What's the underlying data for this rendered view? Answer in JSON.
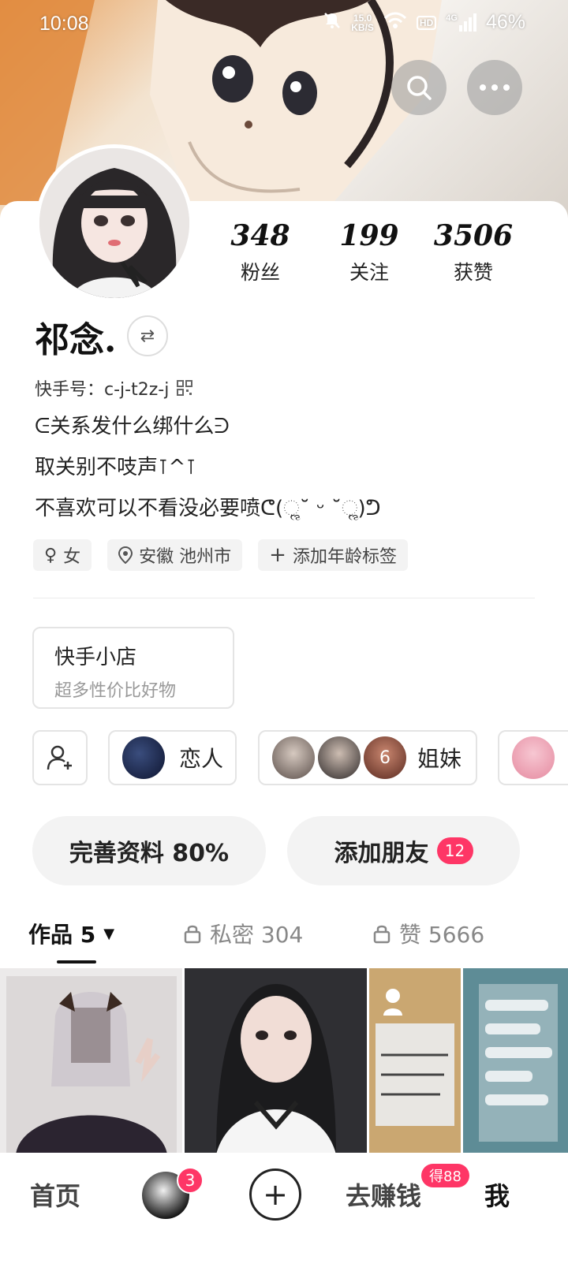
{
  "status_bar": {
    "time": "10:08",
    "net_speed_value": "15.0",
    "net_speed_unit": "KB/S",
    "hd_label": "HD",
    "network_label": "4G",
    "battery": "46%"
  },
  "profile": {
    "nickname": "祁念.",
    "kuaishou_id": "快手号：c-j-t2z-j",
    "bio_lines": [
      "ᕮ关系发什么绑什么ᕭ",
      "取关别不吱声⊺^⊺",
      "不喜欢可以不看没必要喷ᕦ(ૢ˘ ᵕ ˘ૢ)ᕤ"
    ]
  },
  "stats": [
    {
      "value": "348",
      "label": "粉丝"
    },
    {
      "value": "199",
      "label": "关注"
    },
    {
      "value": "3506",
      "label": "获赞"
    }
  ],
  "tags": [
    {
      "icon": "female-icon",
      "text": "女"
    },
    {
      "icon": "location-pin-icon",
      "text": "安徽 池州市"
    },
    {
      "icon": "plus-icon",
      "text": "添加年龄标签"
    }
  ],
  "shop": {
    "title": "快手小店",
    "subtitle": "超多性价比好物"
  },
  "relations": [
    {
      "label": "恋人"
    },
    {
      "label": "姐妹",
      "overlay_digit": "6"
    }
  ],
  "actions": {
    "complete_profile": "完善资料 80%",
    "add_friends": "添加朋友",
    "add_friends_badge": "12"
  },
  "tabs": {
    "works": "作品 5",
    "private": "私密 304",
    "liked": "赞 5666"
  },
  "bottom_nav": {
    "home": "首页",
    "avatar_badge": "3",
    "earn": "去赚钱",
    "earn_badge": "得88",
    "me": "我"
  },
  "colors": {
    "accent_red": "#fe3666",
    "tab_active": "#111111",
    "tab_inactive": "#888888"
  }
}
